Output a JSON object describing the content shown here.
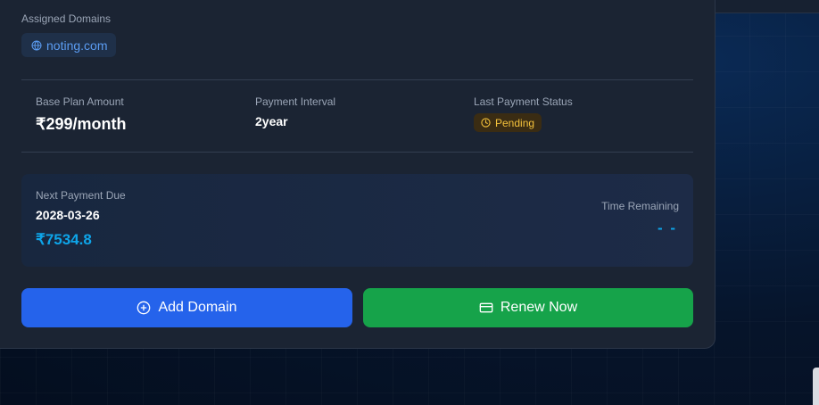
{
  "assigned_domains": {
    "label": "Assigned Domains",
    "domains": [
      {
        "name": "noting.com",
        "icon": "globe-icon"
      }
    ]
  },
  "plan": {
    "base_amount_label": "Base Plan Amount",
    "base_amount_value": "₹299/month",
    "interval_label": "Payment Interval",
    "interval_value": "2year",
    "status_label": "Last Payment Status",
    "status_value": "Pending",
    "status_icon": "clock-icon",
    "status_color": "#f3c13b"
  },
  "next_payment": {
    "label": "Next Payment Due",
    "date": "2028-03-26",
    "amount": "₹7534.8",
    "time_remaining_label": "Time Remaining",
    "time_remaining_value": "- -"
  },
  "actions": {
    "add_domain_label": "Add Domain",
    "add_domain_icon": "plus-circle-icon",
    "renew_label": "Renew Now",
    "renew_icon": "credit-card-icon"
  },
  "colors": {
    "primary_blue": "#2563eb",
    "success_green": "#16a34a",
    "accent_cyan": "#0ea5e9",
    "link_blue": "#5b9cf2"
  }
}
